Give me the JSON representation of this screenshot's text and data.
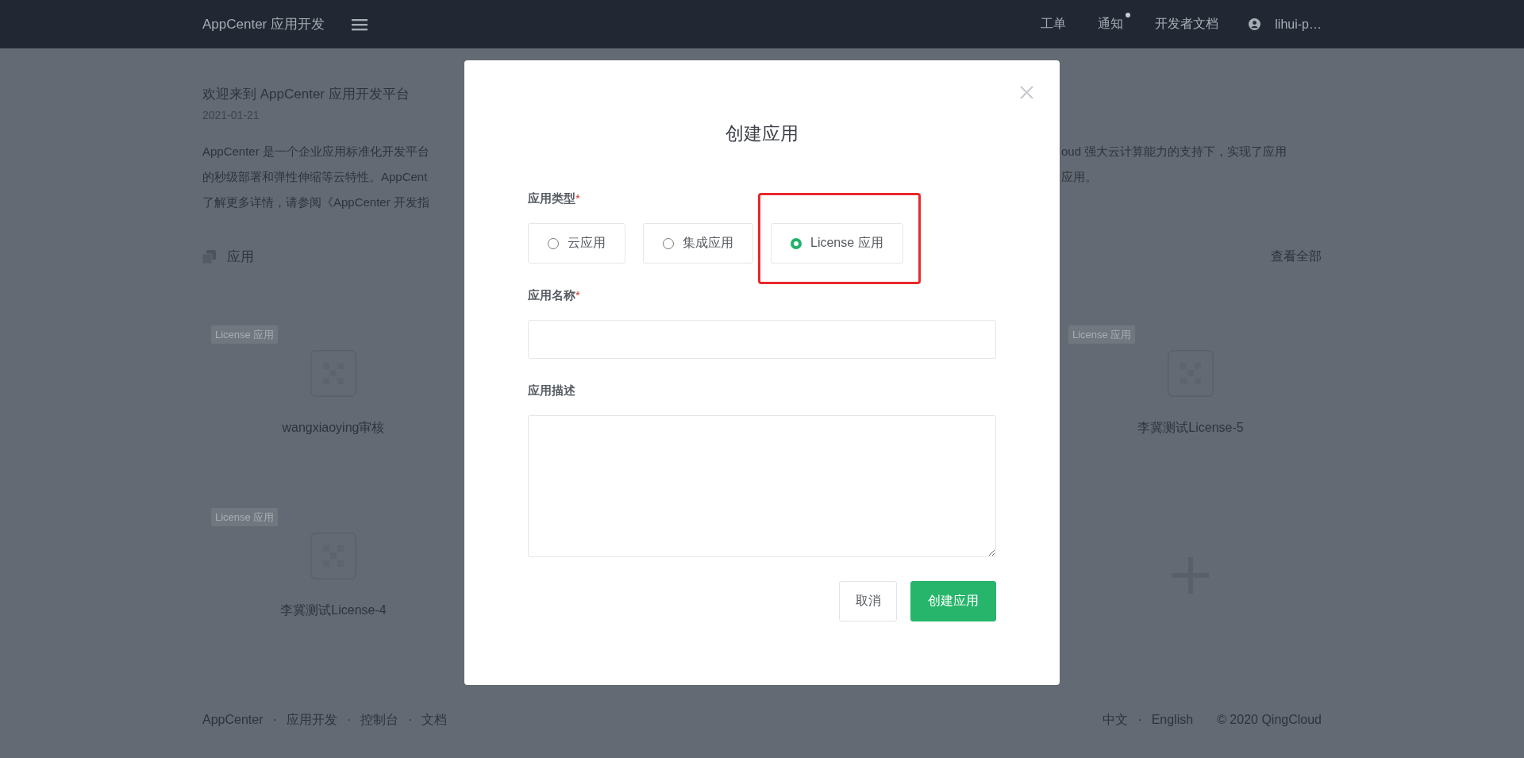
{
  "header": {
    "brand": "AppCenter 应用开发",
    "nav": [
      {
        "label": "工单",
        "has_dot": false
      },
      {
        "label": "通知",
        "has_dot": true
      },
      {
        "label": "开发者文档",
        "has_dot": false
      }
    ],
    "user": "lihui-p…"
  },
  "intro": {
    "title": "欢迎来到 AppCenter 应用开发平台",
    "date": "2021-01-21",
    "lines": [
      {
        "left": "AppCenter 是一个企业应用标准化开发平台",
        "right": "oud 强大云计算能力的支持下，实现了应用"
      },
      {
        "left": "的秒级部署和弹性伸缩等云特性。AppCent",
        "right": "应用。"
      },
      {
        "left": "了解更多详情，请参阅《AppCenter 开发指"
      }
    ]
  },
  "apps": {
    "title": "应用",
    "view_all": "查看全部",
    "left_column": [
      {
        "kind": "app",
        "tag": "License 应用",
        "name": "wangxiaoying审核"
      },
      {
        "kind": "app",
        "tag": "License 应用",
        "name": "李冀测试License-4"
      }
    ],
    "right_column": [
      {
        "kind": "app",
        "tag": "License 应用",
        "name": "李冀测试License-5"
      },
      {
        "kind": "add"
      }
    ]
  },
  "dialog": {
    "title": "创建应用",
    "fields": [
      {
        "kind": "radio",
        "label": "应用类型",
        "required_mark": "*",
        "options": [
          {
            "label": "云应用",
            "selected": false,
            "highlighted": false
          },
          {
            "label": "集成应用",
            "selected": false,
            "highlighted": false
          },
          {
            "label": "License 应用",
            "selected": true,
            "highlighted": true
          }
        ]
      },
      {
        "kind": "input",
        "label": "应用名称",
        "required_mark": "*"
      },
      {
        "kind": "textarea",
        "label": "应用描述"
      }
    ],
    "buttons": [
      {
        "kind": "secondary",
        "label": "取消"
      },
      {
        "kind": "primary",
        "label": "创建应用"
      }
    ]
  },
  "footer": {
    "left": [
      {
        "kind": "link",
        "text": "AppCenter"
      },
      {
        "kind": "separator",
        "text": "·"
      },
      {
        "kind": "link",
        "text": "应用开发"
      },
      {
        "kind": "separator",
        "text": "·"
      },
      {
        "kind": "link",
        "text": "控制台"
      },
      {
        "kind": "separator",
        "text": "·"
      },
      {
        "kind": "link",
        "text": "文档"
      }
    ],
    "right": [
      {
        "kind": "link",
        "text": "中文"
      },
      {
        "kind": "separator",
        "text": "·"
      },
      {
        "kind": "link",
        "text": "English"
      },
      {
        "kind": "copyright",
        "text": "© 2020 QingCloud"
      }
    ]
  }
}
